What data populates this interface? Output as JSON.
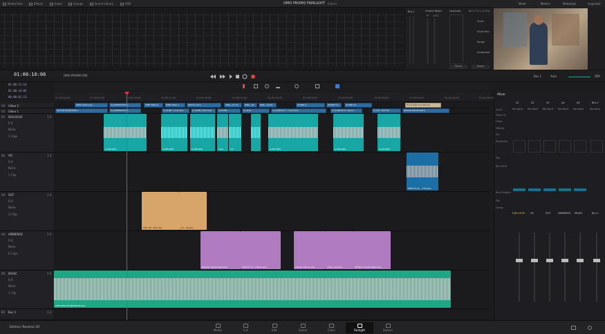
{
  "topbar": {
    "items": [
      "Media Pool",
      "Effects",
      "Index",
      "Groups",
      "Sound Library",
      "ADR"
    ],
    "project_title": "OMO PROMO FAIRLIGHT",
    "project_status": "Edited",
    "right_items": [
      "Mixer",
      "Meters",
      "Metadata",
      "Inspector"
    ]
  },
  "control_room": {
    "title": "Control Room",
    "loudness": "Loudness",
    "standard": "BS.1770-1 (LUFS)",
    "labels": [
      "Short",
      "Short Max",
      "Range",
      "Integrated"
    ],
    "buttons": [
      "Pause",
      "Reset"
    ],
    "bus": "Bus 1",
    "tp": "TP",
    "lufs": "LUFS"
  },
  "transport": {
    "timecode": "01:00:10:06",
    "timeline_name": "OMO PROMO MIX",
    "bus": "Bus 1",
    "auto": "Auto",
    "dim": "DIM"
  },
  "timecodes": [
    {
      "label": "In",
      "value": "01:00:12:14"
    },
    {
      "label": "Out",
      "value": "01:00:14:05"
    },
    {
      "label": "Dur",
      "value": "00:00:01:13"
    }
  ],
  "ruler": [
    "01:00:00:00",
    "01:00:04:00",
    "01:00:08:00",
    "01:00:12:00",
    "01:00:16:00",
    "01:00:20:00",
    "01:00:24:00",
    "01:00:28:00",
    "01:00:32:00",
    "01:00:36:00",
    "01:00:40:00",
    "01:00:44:00",
    "01:00:48:00",
    "01:00:52:00"
  ],
  "video_tracks": [
    {
      "id": "V2",
      "name": "Video 2",
      "clips": [
        "OMO LOGO.png",
        "CI_INTERVIEW.S1",
        "PINE TRAIL K",
        "PINE TRAIL 1",
        "DEVTS_CH 1",
        "PINA _CH 11",
        "PINA _48",
        "PINA _CA.IN",
        "STORE 2",
        "STORE 14",
        "STORE 12",
        "Horizontal Line Reveal"
      ]
    },
    {
      "id": "V1",
      "name": "Video 1",
      "clips": [
        "ORGAN MOUNTAIN 1",
        "CI_INTERVIEW.S1",
        "CI_SUBC...interview",
        "CI_SUBC_interview",
        "CI_SUBC",
        "CI_SUB",
        "CI_SUBCUP 4 - inspiration",
        "CI_SUBCUP 6 - Brand",
        "CI_INT...EW.TOT",
        "ORGAN MOUNTAIN 2"
      ]
    }
  ],
  "audio_tracks": [
    {
      "id": "A1",
      "name": "DIALOGUE",
      "level": "1.0",
      "vol": "0.0",
      "mode": "None",
      "clips_count": "5 Clips",
      "clip_names": [
        "A-002.WAV",
        "A-006.WAV",
        "A-006.WAV",
        "A-00",
        "A-0",
        "A-003.WAV",
        "A-006.WAV",
        "A-004.WAV"
      ]
    },
    {
      "id": "A2",
      "name": "VO",
      "level": "1.0",
      "vol": "0.0",
      "mode": "None",
      "clips_count": "1 Clip",
      "clip_names": [
        "OMO VO_D..._TYD.wav"
      ]
    },
    {
      "id": "A3",
      "name": "SOT",
      "level": "2.0",
      "vol": "0.0",
      "mode": "None",
      "clips_count": "3 Clips",
      "clip_names": [
        "PIKY_58...S04.wav",
        "A-0...04.wav"
      ]
    },
    {
      "id": "A4",
      "name": "AMBIENCE",
      "level": "2.0",
      "vol": "0.0",
      "mode": "None",
      "clips_count": "6 Clips",
      "clip_names": [
        "Exterior Atmos Windows",
        "Exterior Ai...o Birds.wav",
        "Interior atmos.wav",
        "Interi...ds.wav",
        "Outdoor Crowd Walla.wav"
      ]
    },
    {
      "id": "A5",
      "name": "MUSIC",
      "level": "2.0",
      "vol": "0.0",
      "mode": "None",
      "clips_count": "1 Clip",
      "clip_names": [
        "ONE MAN SOUNDTRACK.wav"
      ]
    },
    {
      "id": "B1",
      "name": "Bus 1",
      "level": "2.0",
      "vol": "",
      "mode": "",
      "clips_count": "",
      "clip_names": []
    }
  ],
  "mixer": {
    "title": "Mixer",
    "channels": [
      "A1",
      "A2",
      "A3",
      "A4",
      "A5",
      "Bus 1"
    ],
    "names": [
      "DIALOGUE",
      "VO",
      "SOT",
      "AMBIENCE",
      "MUSIC",
      "Bus 1"
    ],
    "rows": [
      "Input",
      "Track FX",
      "Order",
      "Effects",
      "EQ",
      "Dynamics",
      "Pan",
      "Bus Send",
      "Bus Outputs",
      "Mix",
      "Group"
    ],
    "input_values": [
      "No Input",
      "No Input",
      "No Input",
      "No Input",
      "No Input",
      "No Input"
    ]
  },
  "pages": [
    {
      "label": "Media"
    },
    {
      "label": "Cut"
    },
    {
      "label": "Edit"
    },
    {
      "label": "Fusion"
    },
    {
      "label": "Color"
    },
    {
      "label": "Fairlight",
      "active": true
    },
    {
      "label": "Deliver"
    }
  ],
  "app_name": "DaVinci Resolve 20",
  "colors": {
    "dialogue": "#17a6a4",
    "vo": "#1c6fa4",
    "sot": "#d7a46a",
    "ambience": "#b07bc0",
    "music": "#1ea784",
    "playhead": "#e03a30"
  }
}
